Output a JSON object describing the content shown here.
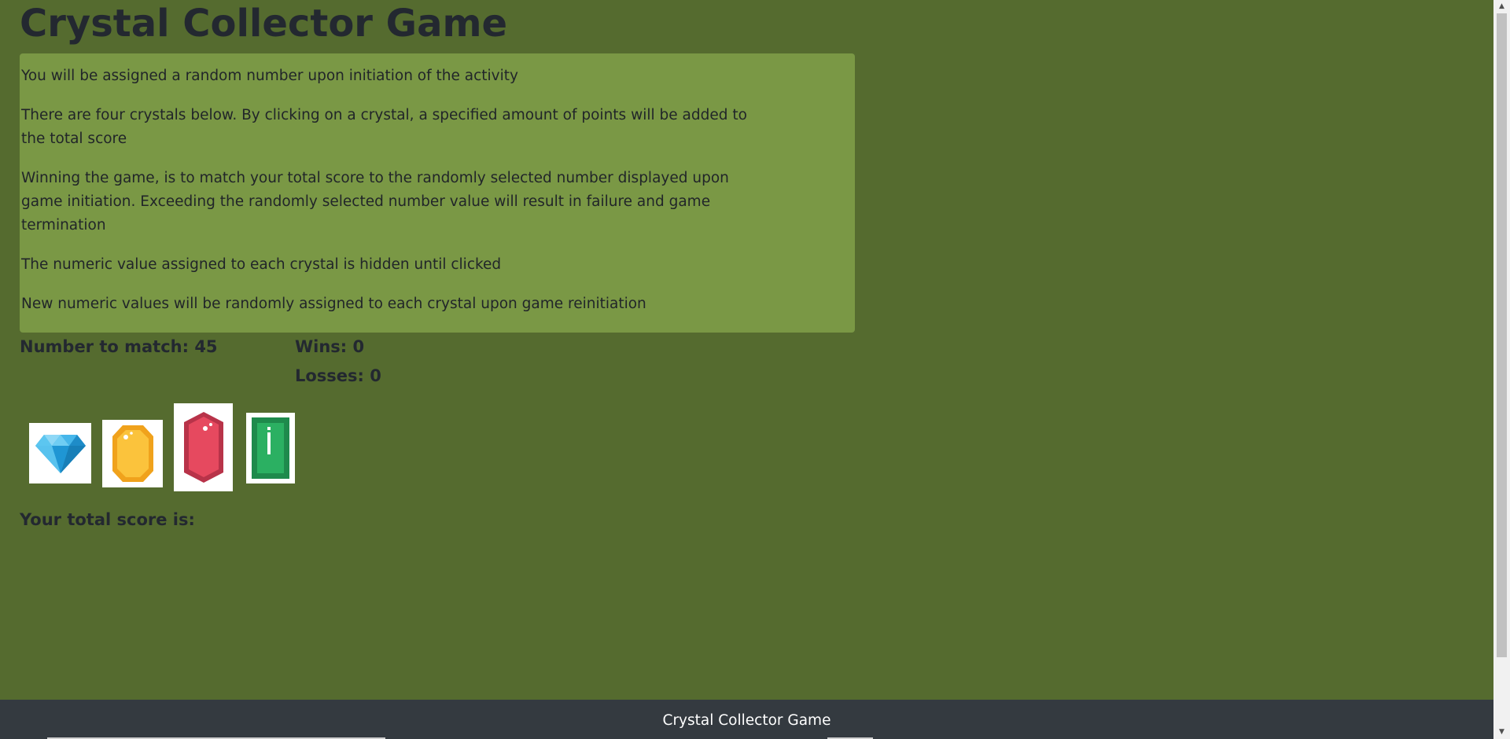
{
  "title": "Crystal Collector Game",
  "instructions": [
    "You will be assigned a random number upon initiation of the activity",
    "There are four crystals below. By clicking on a crystal, a specified amount of points will be added to the total score",
    "Winning the game, is to match your total score to the randomly selected number displayed upon game initiation. Exceeding the randomly selected number value will result in failure and game termination",
    "The numeric value assigned to each crystal is hidden until clicked",
    "New numeric values will be randomly assigned to each crystal upon game reinitiation"
  ],
  "stats": {
    "number_to_match": "Number to match: 45",
    "wins": "Wins: 0",
    "losses": "Losses: 0"
  },
  "crystals": [
    {
      "icon": "blue-diamond-icon",
      "color": "#2fa8e0"
    },
    {
      "icon": "yellow-gem-icon",
      "color": "#f5b21c"
    },
    {
      "icon": "red-gem-icon",
      "color": "#e2495b"
    },
    {
      "icon": "green-gem-icon",
      "color": "#27a35a"
    }
  ],
  "score_label": "Your total score is:",
  "footer": "Crystal Collector Game",
  "colors": {
    "background": "#556b2f",
    "panel": "#7a9845",
    "footer": "#343a40"
  }
}
